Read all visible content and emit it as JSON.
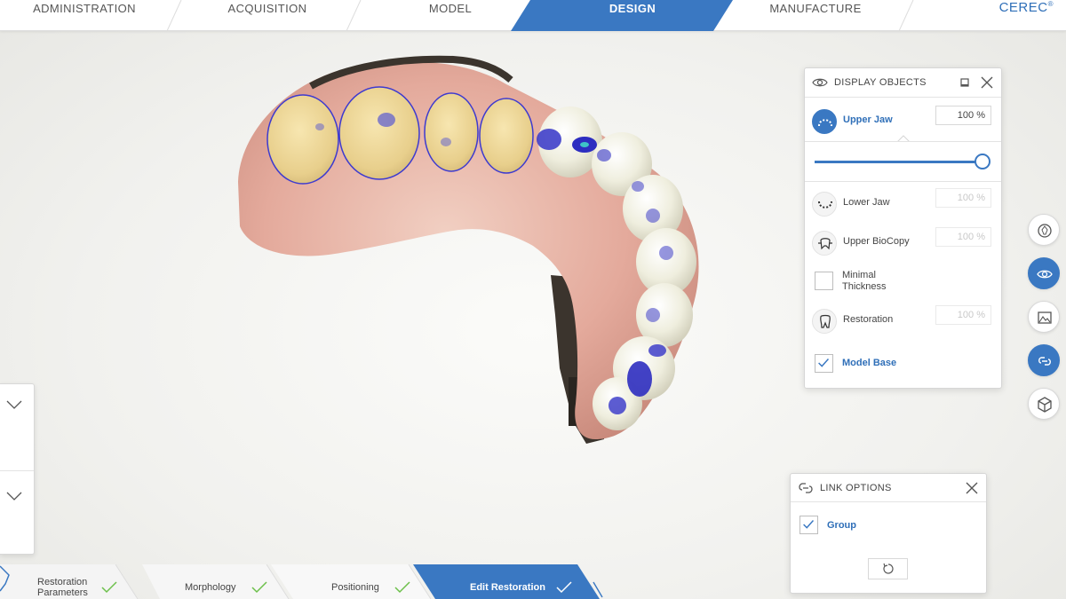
{
  "nav": {
    "tabs": [
      {
        "label": "ADMINISTRATION"
      },
      {
        "label": "ACQUISITION"
      },
      {
        "label": "MODEL"
      },
      {
        "label": "DESIGN",
        "active": true
      },
      {
        "label": "MANUFACTURE"
      }
    ],
    "brand": "CEREC",
    "brand_mark": "®"
  },
  "display_objects": {
    "title": "DISPLAY OBJECTS",
    "rows": [
      {
        "label": "Upper Jaw",
        "value": "100 %",
        "active": true
      },
      {
        "label": "Lower Jaw",
        "value": "100 %"
      },
      {
        "label": "Upper BioCopy",
        "value": "100 %"
      },
      {
        "label": "Minimal\nThickness",
        "line1": "Minimal",
        "line2": "Thickness"
      },
      {
        "label": "Restoration",
        "value": "100 %"
      },
      {
        "label": "Model Base",
        "checked": true
      }
    ],
    "slider_value": 1.0
  },
  "link_options": {
    "title": "LINK OPTIONS",
    "group_label": "Group",
    "group_checked": true
  },
  "steps": [
    {
      "line1": "Restoration",
      "line2": "Parameters",
      "done": true
    },
    {
      "label": "Morphology",
      "done": true
    },
    {
      "label": "Positioning",
      "done": true
    },
    {
      "label": "Edit Restoration",
      "done": true,
      "active": true
    }
  ],
  "colors": {
    "accent": "#3a78c2",
    "check": "#6cc04a"
  },
  "icons": [
    "eye-icon",
    "upper-jaw-icon",
    "lower-jaw-icon",
    "biocopy-icon",
    "tooth-icon",
    "link-icon",
    "reset-icon",
    "cube-icon",
    "image-icon",
    "model-icon"
  ]
}
